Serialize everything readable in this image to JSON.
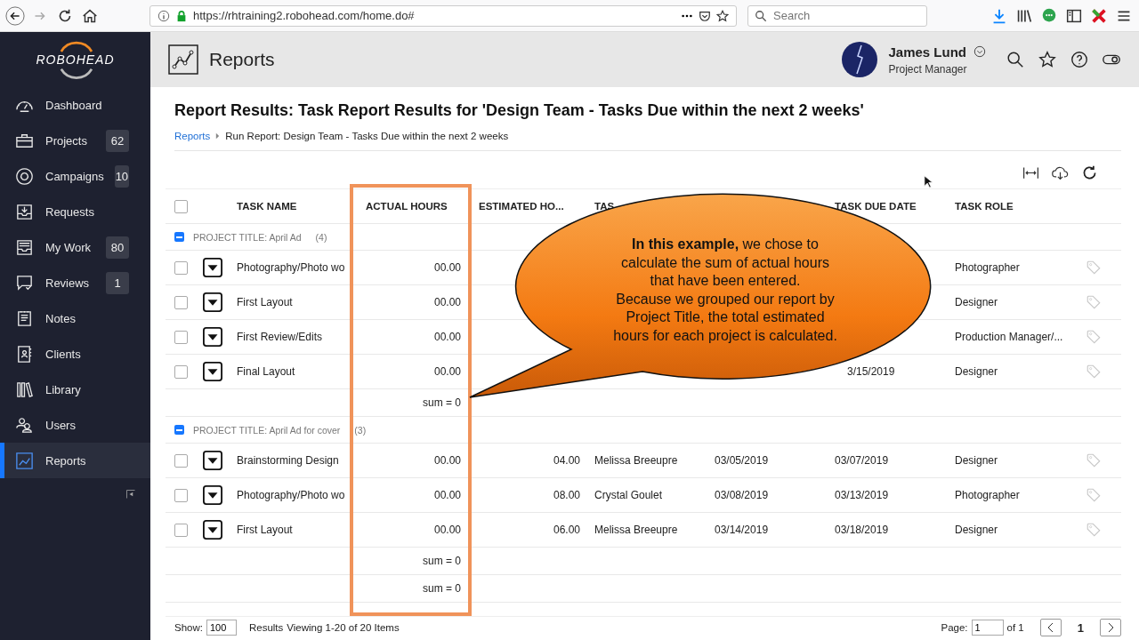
{
  "browser": {
    "url": "https://rhtraining2.robohead.com/home.do#",
    "search_placeholder": "Search"
  },
  "sidebar": {
    "logo": "ROBOHEAD",
    "items": [
      {
        "label": "Dashboard",
        "selected": false
      },
      {
        "label": "Projects",
        "badge": "62",
        "selected": false
      },
      {
        "label": "Campaigns",
        "badge": "10",
        "selected": false
      },
      {
        "label": "Requests",
        "selected": false
      },
      {
        "label": "My Work",
        "badge": "80",
        "selected": false
      },
      {
        "label": "Reviews",
        "badge": "1",
        "selected": false
      },
      {
        "label": "Notes",
        "selected": false
      },
      {
        "label": "Clients",
        "selected": false
      },
      {
        "label": "Library",
        "selected": false
      },
      {
        "label": "Users",
        "selected": false
      },
      {
        "label": "Reports",
        "selected": true
      }
    ]
  },
  "header": {
    "title": "Reports",
    "user_name": "James Lund",
    "user_role": "Project Manager"
  },
  "report": {
    "title": "Report Results: Task Report Results for 'Design Team - Tasks Due within the next 2 weeks'",
    "breadcrumb": [
      {
        "label": "Reports",
        "kind": "link"
      },
      {
        "label": "Run Report: Design Team - Tasks Due within the next 2 weeks",
        "kind": "current"
      }
    ]
  },
  "table": {
    "select_all_checked": false,
    "columns": {
      "task_name": "TASK NAME",
      "actual_hours": "ACTUAL HOURS",
      "estimated_hours": "ESTIMATED HO...",
      "column_6": "TAS",
      "task_due_date": "TASK DUE DATE",
      "task_role": "TASK ROLE"
    },
    "rows": [
      {
        "kind": "group",
        "label": "PROJECT TITLE: April Ad",
        "count": "(4)",
        "expanded": true
      },
      {
        "kind": "task",
        "checked": false,
        "name": "Photography/Photo wo",
        "actual": "00.00",
        "role": "Photographer"
      },
      {
        "kind": "task",
        "checked": false,
        "name": "First Layout",
        "actual": "00.00",
        "role": "Designer"
      },
      {
        "kind": "task",
        "checked": false,
        "name": "First Review/Edits",
        "actual": "00.00",
        "role": "Production Manager/..."
      },
      {
        "kind": "task",
        "checked": false,
        "name": "Final Layout",
        "actual": "00.00",
        "due": "3/15/2019",
        "role": "Designer"
      },
      {
        "kind": "sum",
        "actual": "sum = 0"
      },
      {
        "kind": "group",
        "label": "PROJECT TITLE: April Ad for cover",
        "count": "(3)",
        "expanded": true
      },
      {
        "kind": "task",
        "checked": false,
        "name": "Brainstorming Design",
        "actual": "00.00",
        "estimated": "04.00",
        "assignee": "Melissa Breeupre",
        "start": "03/05/2019",
        "due": "03/07/2019",
        "role": "Designer"
      },
      {
        "kind": "task",
        "checked": false,
        "name": "Photography/Photo wo",
        "actual": "00.00",
        "estimated": "08.00",
        "assignee": "Crystal Goulet",
        "start": "03/08/2019",
        "due": "03/13/2019",
        "role": "Photographer"
      },
      {
        "kind": "task",
        "checked": false,
        "name": "First Layout",
        "actual": "00.00",
        "estimated": "06.00",
        "assignee": "Melissa Breeupre",
        "start": "03/14/2019",
        "due": "03/18/2019",
        "role": "Designer"
      },
      {
        "kind": "sum",
        "actual": "sum = 0"
      },
      {
        "kind": "sum",
        "actual": "sum = 0"
      }
    ]
  },
  "callout": {
    "paragraphs": [
      "**In this example,** we chose to calculate the sum of actual hours that have been entered.",
      "Because we grouped our report by Project Title, the total estimated hours for each project is calculated."
    ]
  },
  "footer": {
    "show_label": "Show:",
    "show_value": "100",
    "results_label": "Results",
    "viewing": "Viewing 1-20 of 20 Items",
    "page_label": "Page:",
    "page_value": "1",
    "page_of": "of 1",
    "current_page": "1"
  }
}
